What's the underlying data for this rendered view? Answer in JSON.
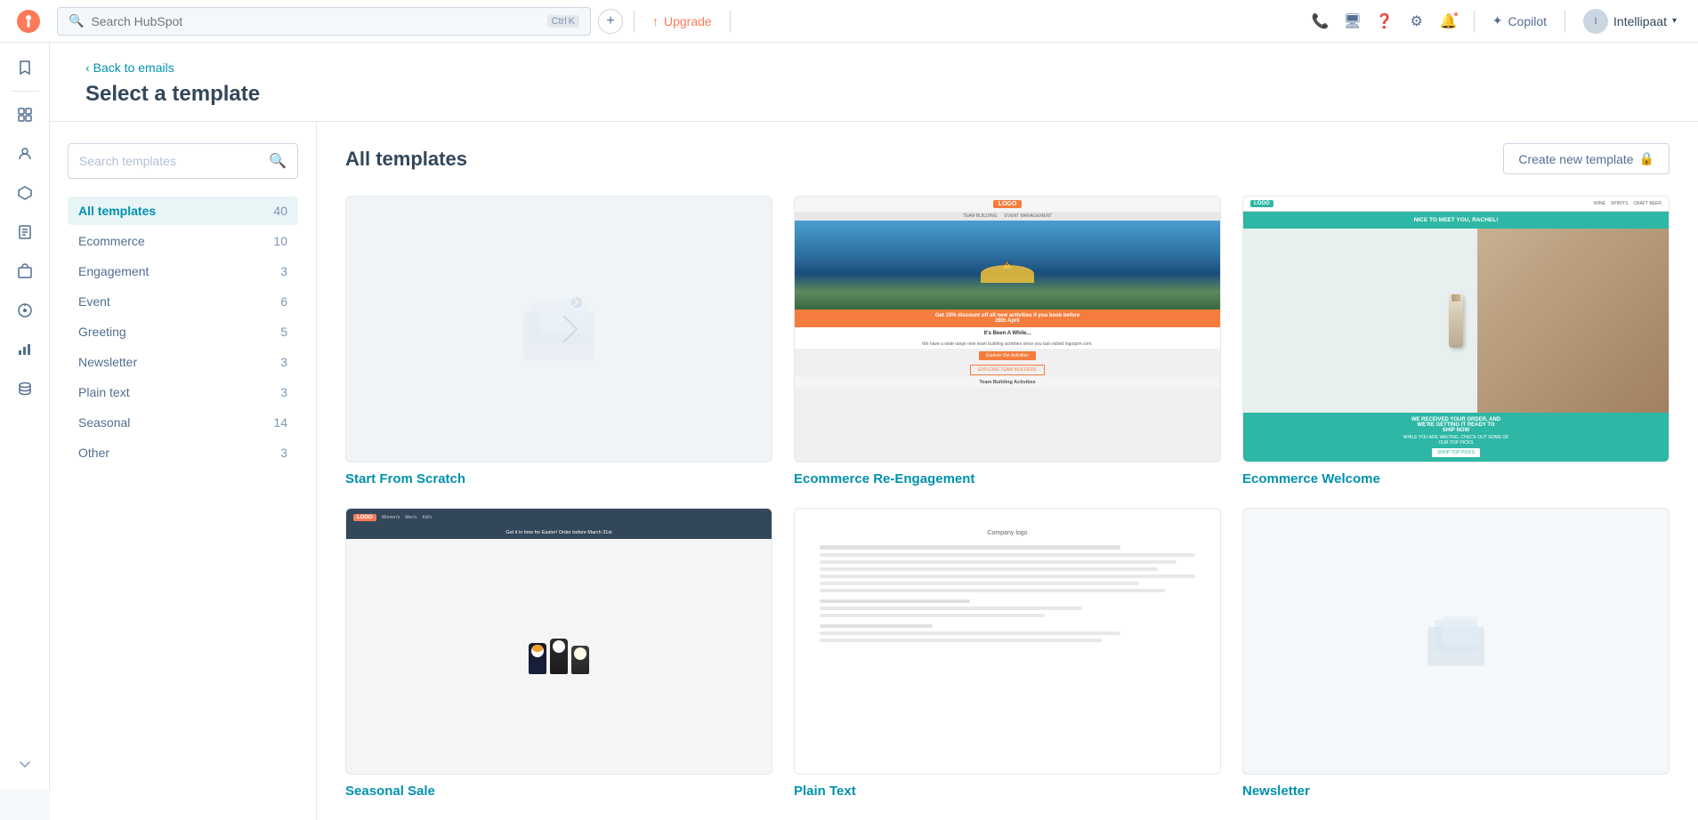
{
  "topnav": {
    "search_placeholder": "Search HubSpot",
    "shortcut_ctrl": "Ctrl",
    "shortcut_key": "K",
    "upgrade_label": "Upgrade",
    "copilot_label": "Copilot",
    "user_label": "Intellipaat",
    "plus_label": "+"
  },
  "sidebar": {
    "items": [
      {
        "name": "bookmark-icon",
        "icon": "🔖"
      },
      {
        "name": "dash-icon",
        "icon": "—"
      },
      {
        "name": "grid-icon",
        "icon": "⊞"
      },
      {
        "name": "contacts-icon",
        "icon": "👤"
      },
      {
        "name": "marketing-icon",
        "icon": "📣"
      },
      {
        "name": "doc-icon",
        "icon": "📄"
      },
      {
        "name": "box-icon",
        "icon": "📦"
      },
      {
        "name": "network-icon",
        "icon": "⬡"
      },
      {
        "name": "bar-chart-icon",
        "icon": "📊"
      },
      {
        "name": "db-icon",
        "icon": "🗄"
      },
      {
        "name": "folder-icon",
        "icon": "📁"
      }
    ],
    "chevron_down": "˅"
  },
  "header": {
    "back_label": "Back to emails",
    "title": "Select a template"
  },
  "filter": {
    "search_placeholder": "Search templates",
    "categories": [
      {
        "label": "All templates",
        "count": 40,
        "active": true
      },
      {
        "label": "Ecommerce",
        "count": 10,
        "active": false
      },
      {
        "label": "Engagement",
        "count": 3,
        "active": false
      },
      {
        "label": "Event",
        "count": 6,
        "active": false
      },
      {
        "label": "Greeting",
        "count": 5,
        "active": false
      },
      {
        "label": "Newsletter",
        "count": 3,
        "active": false
      },
      {
        "label": "Plain text",
        "count": 3,
        "active": false
      },
      {
        "label": "Seasonal",
        "count": 14,
        "active": false
      },
      {
        "label": "Other",
        "count": 3,
        "active": false
      }
    ]
  },
  "templates": {
    "section_title": "All templates",
    "create_button": "Create new template",
    "items": [
      {
        "id": "scratch",
        "name": "Start From Scratch",
        "type": "scratch"
      },
      {
        "id": "reengage",
        "name": "Ecommerce Re-Engagement",
        "type": "reengage"
      },
      {
        "id": "welcome",
        "name": "Ecommerce Welcome",
        "type": "welcome"
      },
      {
        "id": "seasonal1",
        "name": "Seasonal Sale",
        "type": "seasonal"
      },
      {
        "id": "plain1",
        "name": "Plain Text",
        "type": "plain"
      },
      {
        "id": "newsletter1",
        "name": "Newsletter",
        "type": "newsletter"
      }
    ]
  }
}
